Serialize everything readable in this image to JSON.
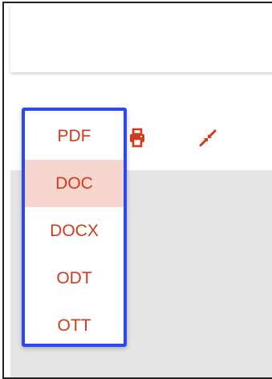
{
  "colors": {
    "accent": "#d23a1c",
    "selected_bg": "#f7d6cf",
    "focus_border": "#2c48f0",
    "content_bg": "#e5e5e5"
  },
  "toolbar": {
    "print_icon": "print-icon",
    "compress_icon": "compress-arrows-icon"
  },
  "format_menu": {
    "items": [
      {
        "label": "PDF",
        "selected": false
      },
      {
        "label": "DOC",
        "selected": true
      },
      {
        "label": "DOCX",
        "selected": false
      },
      {
        "label": "ODT",
        "selected": false
      },
      {
        "label": "OTT",
        "selected": false
      }
    ]
  }
}
